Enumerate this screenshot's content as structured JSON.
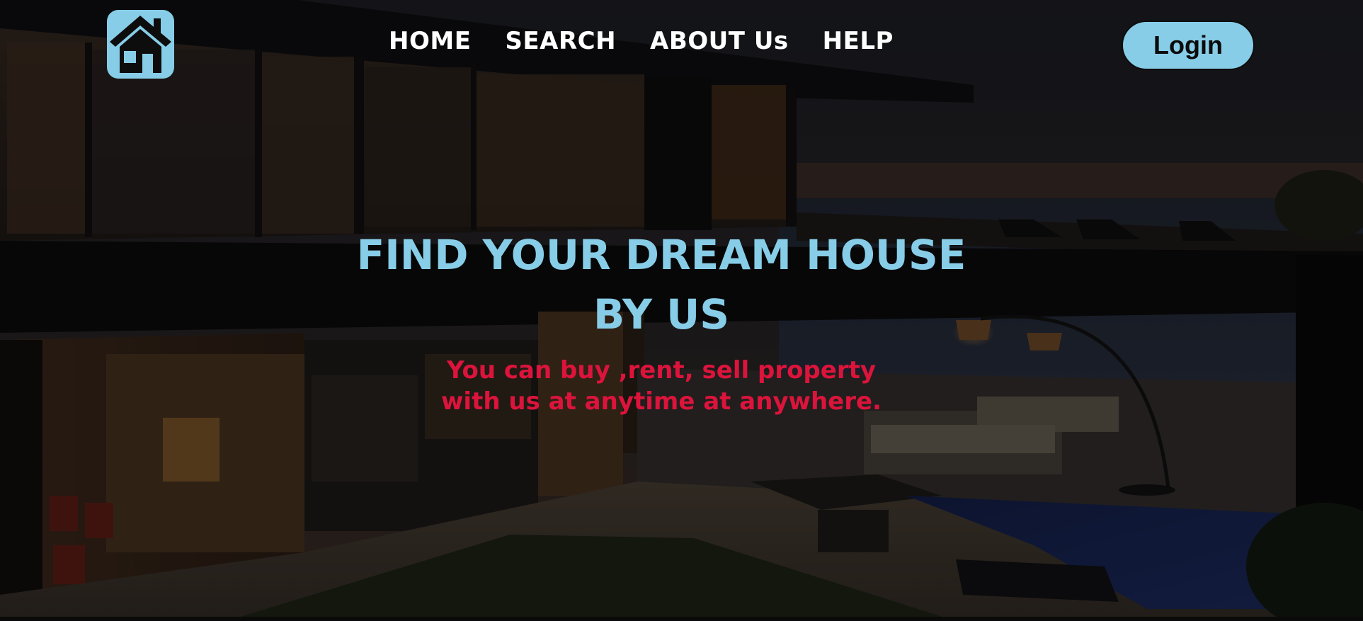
{
  "header": {
    "logo_icon": "house-icon",
    "nav": [
      {
        "label": "HOME"
      },
      {
        "label": "SEARCH"
      },
      {
        "label": "ABOUT Us"
      },
      {
        "label": "HELP"
      }
    ],
    "login_label": "Login"
  },
  "hero": {
    "background": "modern-villa-night-photo",
    "title_line1": "FIND YOUR DREAM HOUSE",
    "title_line2": "BY US",
    "subtitle_line1": "You can buy ,rent, sell property",
    "subtitle_line2": "with us at anytime at anywhere."
  },
  "colors": {
    "accent": "#87cde8",
    "subtitle": "#dc143c",
    "nav_text": "#ffffff"
  }
}
